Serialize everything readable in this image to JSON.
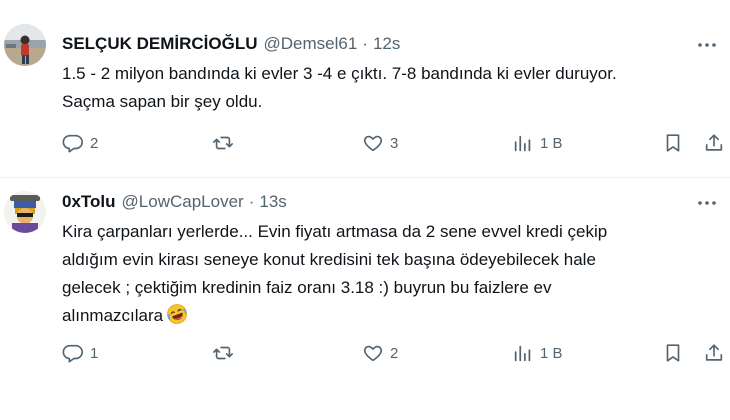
{
  "tweets": [
    {
      "author_name": "SELÇUK DEMİRCİOĞLU",
      "handle": "@Demsel61",
      "separator": "·",
      "time": "12s",
      "text_lines": [
        "1.5 - 2 milyon bandında ki evler 3 -4 e çıktı. 7-8 bandında ki evler duruyor.",
        "Saçma sapan bir şey oldu."
      ],
      "replies": "2",
      "retweets": "",
      "likes": "3",
      "views": "1 B"
    },
    {
      "author_name": "0xTolu",
      "handle": "@LowCapLover",
      "separator": "·",
      "time": "13s",
      "text_lines": [
        "Kira çarpanları yerlerde... Evin fiyatı artmasa da 2 sene evvel kredi çekip",
        "aldığım evin kirası seneye konut kredisini tek başına ödeyebilecek hale",
        "gelecek ; çektiğim kredinin faiz oranı 3.18 :) buyrun bu faizlere ev",
        "alınmazcılara"
      ],
      "emoji": "rolling-on-the-floor-laughing",
      "replies": "1",
      "retweets": "",
      "likes": "2",
      "views": "1 B"
    }
  ],
  "colors": {
    "text": "#0f1419",
    "secondary": "#536471",
    "divider": "#eff3f4"
  }
}
